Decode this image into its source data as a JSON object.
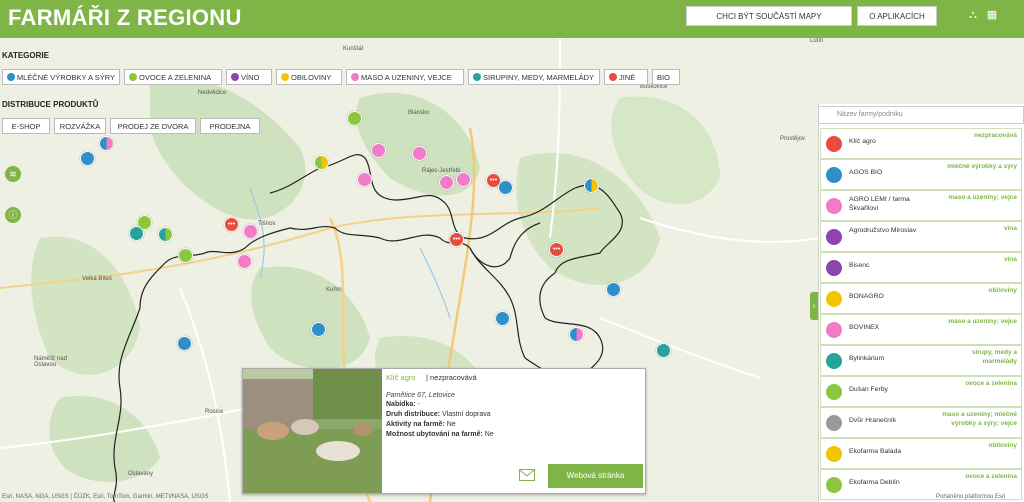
{
  "header": {
    "title": "FARMÁŘI Z REGIONU",
    "join_label": "CHCI BÝT SOUČÁSTÍ MAPY",
    "about_label": "O APLIKACÍCH"
  },
  "filters": {
    "category_title": "KATEGORIE",
    "categories": [
      {
        "label": "MLÉČNÉ VÝROBKY A SÝRY",
        "color": "#2e8fc9"
      },
      {
        "label": "OVOCE A ZELENINA",
        "color": "#8cc63f"
      },
      {
        "label": "VÍNO",
        "color": "#8e44ad"
      },
      {
        "label": "OBILOVINY",
        "color": "#f2c500"
      },
      {
        "label": "MASO A UZENINY, VEJCE",
        "color": "#f07cc8"
      },
      {
        "label": "SIRUPINY, MEDY, MARMELÁDY",
        "color": "#27a39b"
      },
      {
        "label": "JINÉ",
        "color": "#e84c3d"
      },
      {
        "label": "BIO",
        "color": ""
      }
    ],
    "distribution_title": "DISTRIBUCE PRODUKTŮ",
    "distribution": [
      "E-SHOP",
      "ROZVÁŽKA",
      "PRODEJ ZE DVORA",
      "PRODEJNA"
    ]
  },
  "map_labels": [
    "Kunštát",
    "Nedvědice",
    "Blansko",
    "Rájec-Jestřebí",
    "Tišnov",
    "Velká Bíteš",
    "Kuřim",
    "Náměšť nad Oslavou",
    "Rosice",
    "Oslavany",
    "Prostějov",
    "Lutín",
    "Boskovice"
  ],
  "search": {
    "placeholder": "Název farmy/podniku"
  },
  "farms": [
    {
      "name": "Klíč agro",
      "category": "nezpracovává",
      "color": "#e84c3d"
    },
    {
      "name": "AGOS BIO",
      "category": "mléčné výrobky a sýry",
      "color": "#2e8fc9"
    },
    {
      "name": "AGRO LEMI / farma Škvařilovi",
      "category": "maso a uzeniny; vejce",
      "color": "#f07cc8"
    },
    {
      "name": "Agrodružstvo Miroslav",
      "category": "vína",
      "color": "#8e44ad"
    },
    {
      "name": "Bisenc",
      "category": "vína",
      "color": "#8e44ad"
    },
    {
      "name": "BONAGRO",
      "category": "obiloviny",
      "color": "#f2c500"
    },
    {
      "name": "BOVINEX",
      "category": "maso a uzeniny; vejce",
      "color": "#f07cc8"
    },
    {
      "name": "Bylinkárium",
      "category": "sirupy, medy a marmelády",
      "color": "#27a39b"
    },
    {
      "name": "Dušan Ferby",
      "category": "ovoce a zelenina",
      "color": "#8cc63f"
    },
    {
      "name": "Dvůr Hranečník",
      "category": "maso a uzeniny; mléčné výrobky a sýry; vejce",
      "color": "#999999"
    },
    {
      "name": "Ekofarma Balada",
      "category": "obiloviny",
      "color": "#f2c500"
    },
    {
      "name": "Ekofarma Deblín",
      "category": "ovoce a zelenina",
      "color": "#8cc63f"
    }
  ],
  "popup": {
    "name": "Klíč agro",
    "status": "| nezpracovává",
    "address": "Pamětice 67, Letovice",
    "offer_label": "Nabídka:",
    "offer_value": "-",
    "dist_label": "Druh distribuce:",
    "dist_value": "Vlastní doprava",
    "activities_label": "Aktivity na farmě:",
    "activities_value": "Ne",
    "lodging_label": "Možnost ubytování na farmě:",
    "lodging_value": "Ne",
    "web_label": "Webová stránka"
  },
  "attribution": {
    "sources": "Esri, NASA, NGA, USGS | ČÚZK, Esri, TomTom, Garmin, METI/NASA, USGS",
    "powered": "Poháněno platformou Esri"
  }
}
